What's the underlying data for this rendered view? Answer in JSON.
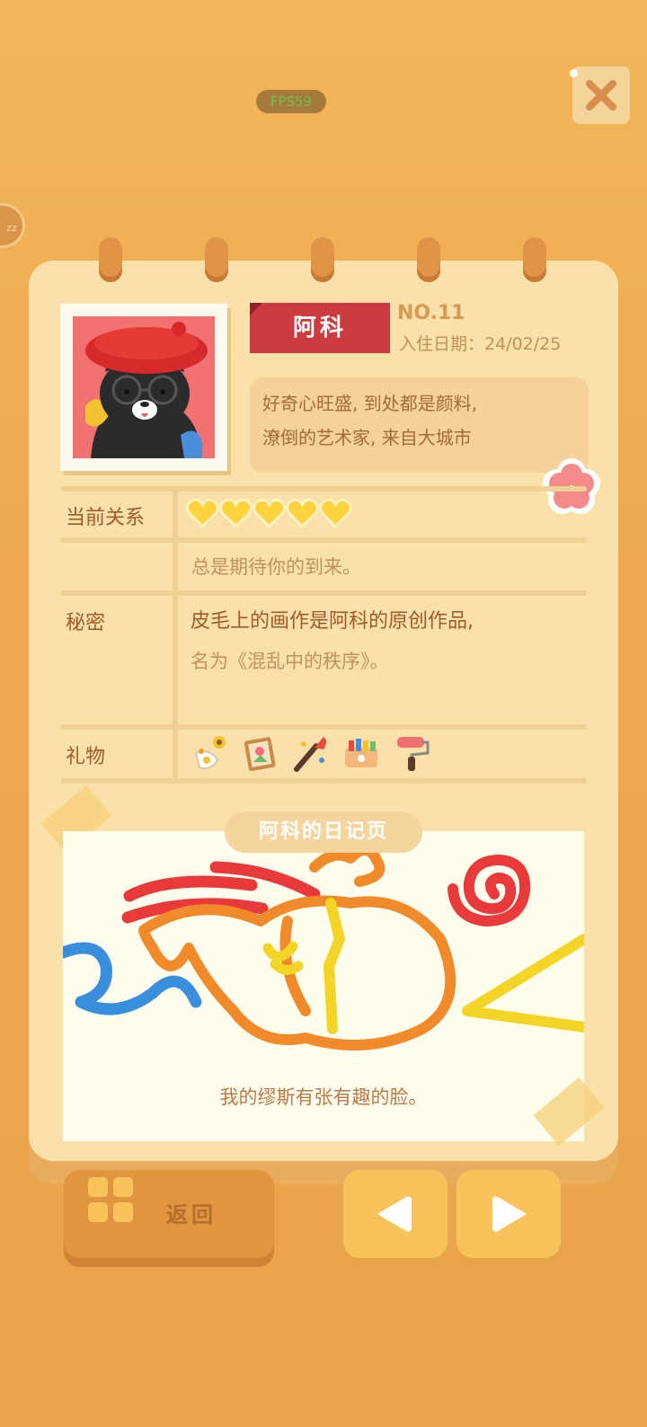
{
  "hud": {
    "fps": "FPS59",
    "side_badge": "zz"
  },
  "profile": {
    "name": "阿科",
    "number": "NO.11",
    "date_label": "入住日期：24/02/25",
    "desc_line1": "好奇心旺盛, 到处都是颜料,",
    "desc_line2": "潦倒的艺术家, 来自大城市"
  },
  "relationship": {
    "label": "当前关系",
    "hearts_filled": 5,
    "hearts_total": 5,
    "status": "总是期待你的到来。"
  },
  "secret": {
    "label": "秘密",
    "line1": "皮毛上的画作是阿科的原创作品,",
    "line2": "名为《混乱中的秩序》。"
  },
  "gifts": {
    "label": "礼物",
    "items": [
      "sunflower-vase-icon",
      "picture-frame-icon",
      "paint-brush-icon",
      "paint-box-icon",
      "paint-roller-icon"
    ]
  },
  "diary": {
    "title": "阿科的日记页",
    "caption": "我的缪斯有张有趣的脸。"
  },
  "buttons": {
    "back": "返回"
  },
  "colors": {
    "name_tag": "#cb3b3f",
    "heart": "#ffd23f",
    "page": "#fae1aa"
  }
}
